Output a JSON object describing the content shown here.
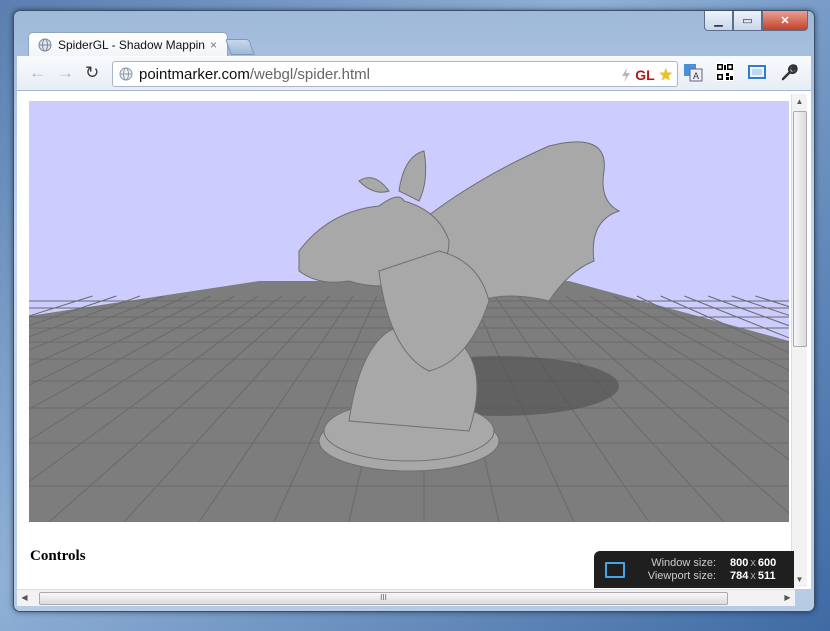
{
  "window": {
    "min_glyph": "▁",
    "max_glyph": "▭",
    "close_glyph": "✕"
  },
  "tab": {
    "title": "SpiderGL - Shadow Mappin",
    "close_glyph": "×"
  },
  "toolbar": {
    "back_glyph": "←",
    "forward_glyph": "→",
    "reload_glyph": "↻",
    "url_host": "pointmarker.com",
    "url_path": "/webgl/spider.html",
    "gl_badge": "GL",
    "star_glyph": "★"
  },
  "page": {
    "controls_heading": "Controls",
    "scene_colors": {
      "sky": "#ccccff",
      "floor": "#7d7d7d",
      "grid": "#6a6a6a",
      "model": "#a8a8a8"
    }
  },
  "resizer": {
    "window_label": "Window size:",
    "window_w": "800",
    "window_h": "600",
    "viewport_label": "Viewport size:",
    "viewport_w": "784",
    "viewport_h": "511",
    "sep": "x"
  },
  "scrollbars": {
    "up": "▲",
    "down": "▼",
    "left": "◀",
    "right": "▶",
    "grip": "III"
  }
}
